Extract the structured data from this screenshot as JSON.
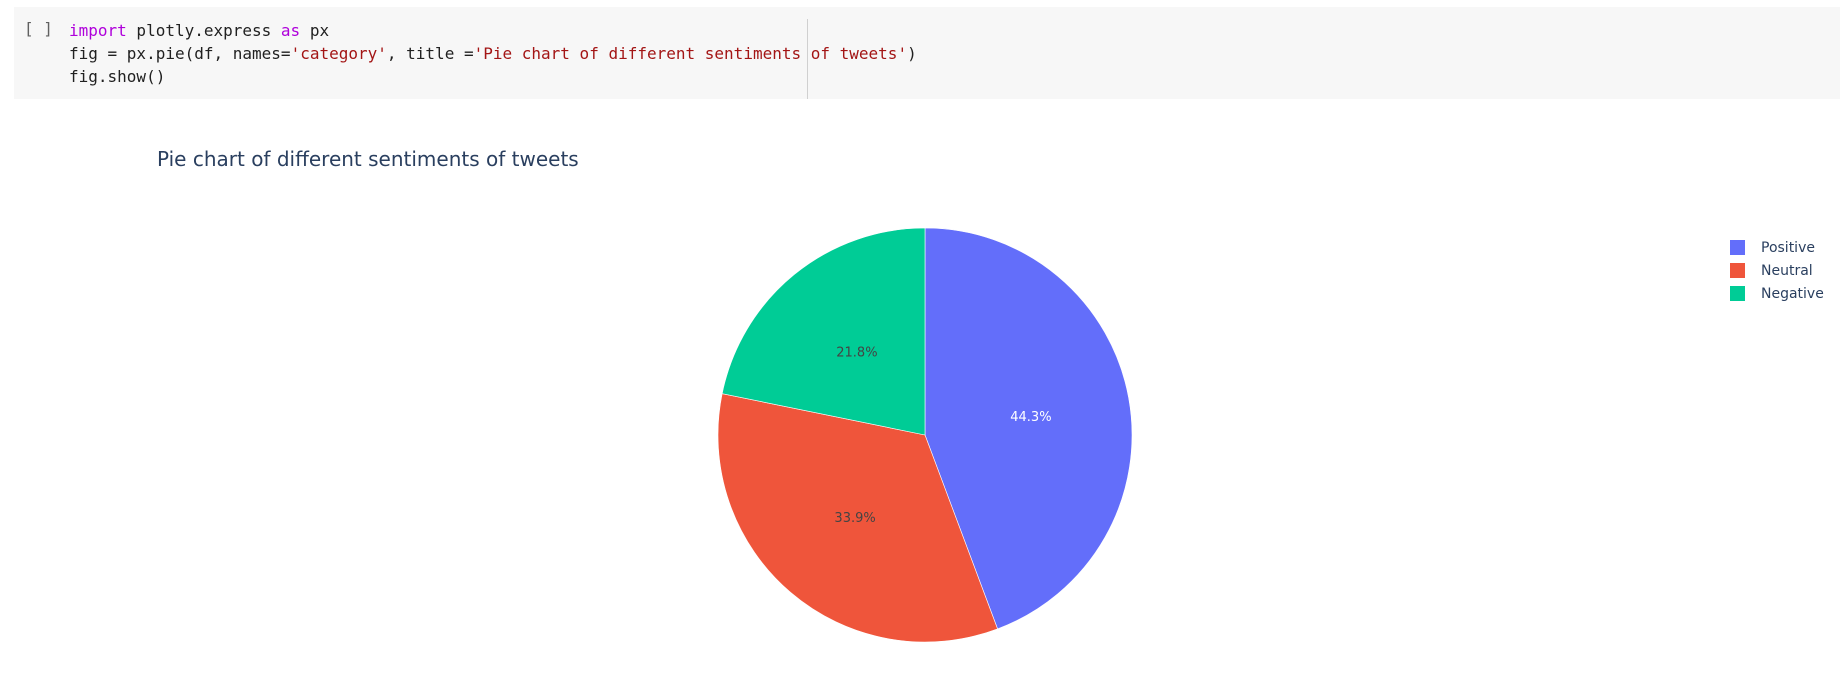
{
  "cell": {
    "prompt": "[ ]",
    "code_lines": [
      [
        {
          "t": "import",
          "c": "kw"
        },
        {
          "t": " plotly.express ",
          "c": ""
        },
        {
          "t": "as",
          "c": "kw"
        },
        {
          "t": " px",
          "c": ""
        }
      ],
      [
        {
          "t": "fig = px.pie(df, names=",
          "c": ""
        },
        {
          "t": "'category'",
          "c": "str"
        },
        {
          "t": ", title =",
          "c": ""
        },
        {
          "t": "'Pie chart of different sentiments of tweets'",
          "c": "str"
        },
        {
          "t": ")",
          "c": ""
        }
      ],
      [
        {
          "t": "fig.show()",
          "c": ""
        }
      ]
    ]
  },
  "chart_data": {
    "type": "pie",
    "title": "Pie chart of different sentiments of tweets",
    "categories": [
      "Positive",
      "Neutral",
      "Negative"
    ],
    "values": [
      44.3,
      33.9,
      21.8
    ],
    "value_labels": [
      "44.3%",
      "33.9%",
      "21.8%"
    ],
    "colors": [
      "#636efa",
      "#ef553b",
      "#00cc96"
    ],
    "label_colors": [
      "#ffffff",
      "#444444",
      "#444444"
    ],
    "legend_position": "top-right",
    "direction": "clockwise",
    "start": "top"
  }
}
